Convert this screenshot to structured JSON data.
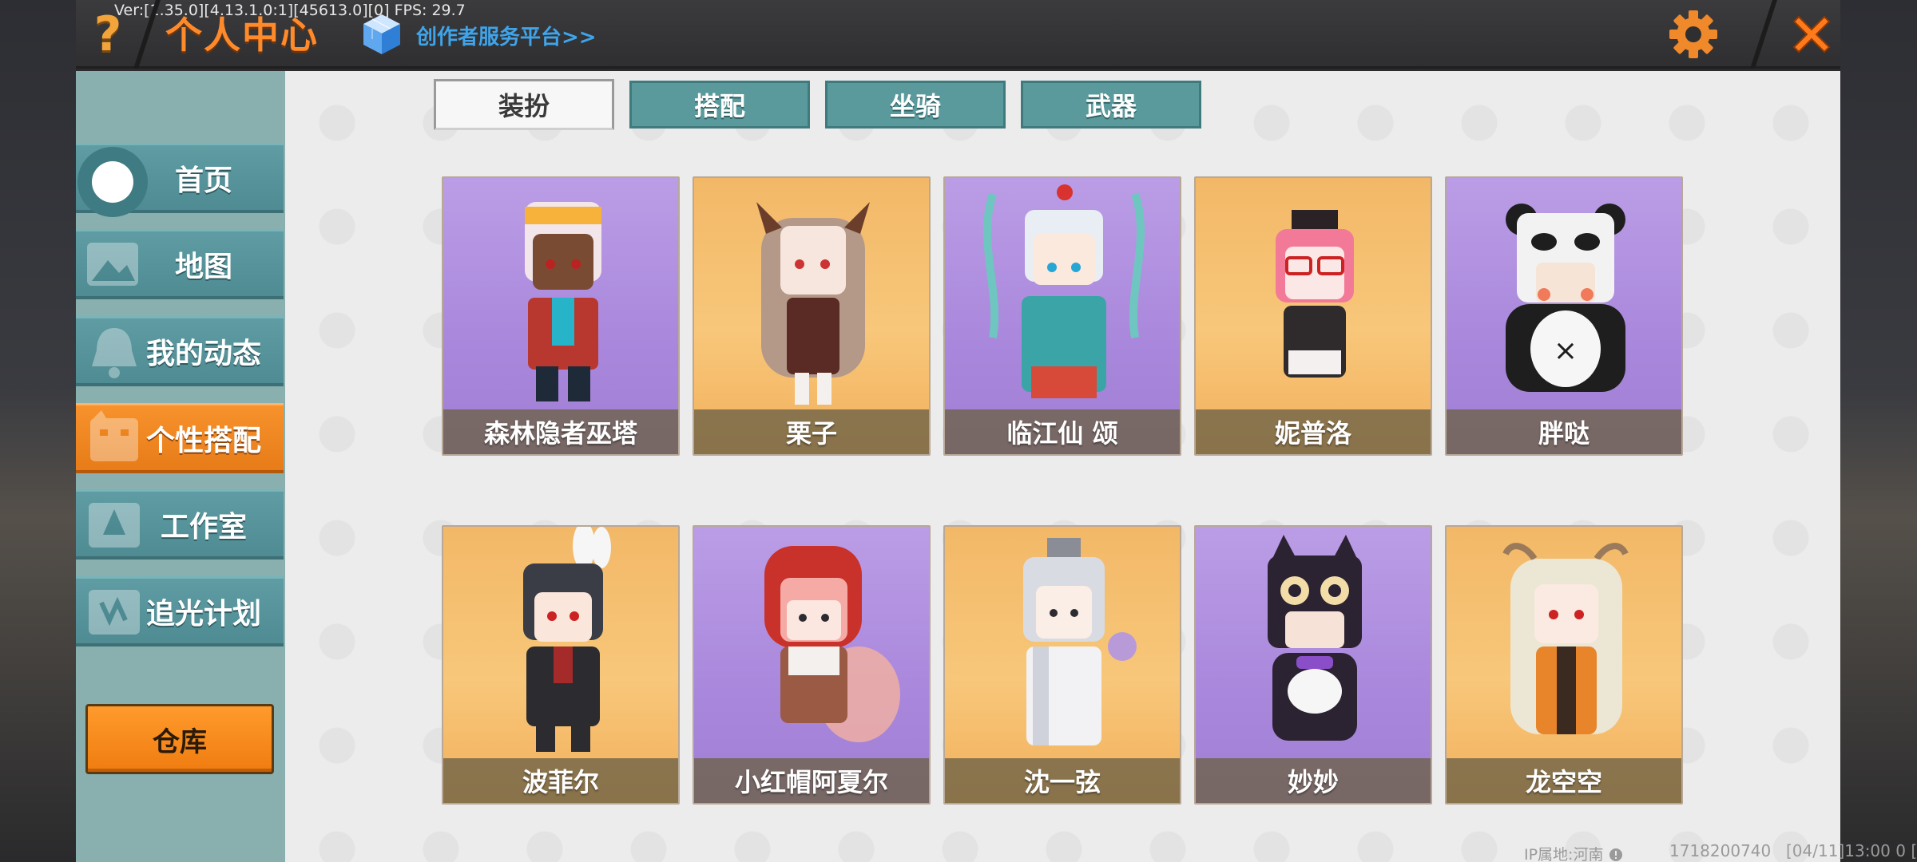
{
  "header": {
    "version": "Ver:[1.35.0][4.13.1.0:1][45613.0][0] FPS: 29.7",
    "title": "个人中心",
    "creator_link": "创作者服务平台>>",
    "help_icon": "question-icon",
    "settings_icon": "gear-icon",
    "close_icon": "close-icon"
  },
  "sidebar": {
    "items": [
      {
        "label": "首页",
        "icon": "home-icon"
      },
      {
        "label": "地图",
        "icon": "map-icon"
      },
      {
        "label": "我的动态",
        "icon": "bell-icon"
      },
      {
        "label": "个性搭配",
        "icon": "outfit-icon"
      },
      {
        "label": "工作室",
        "icon": "studio-icon"
      },
      {
        "label": "追光计划",
        "icon": "plan-icon"
      }
    ],
    "active": "个性搭配",
    "warehouse_label": "仓库"
  },
  "tabs": [
    {
      "label": "装扮",
      "active": true
    },
    {
      "label": "搭配",
      "active": false
    },
    {
      "label": "坐骑",
      "active": false
    },
    {
      "label": "武器",
      "active": false
    }
  ],
  "characters": [
    {
      "name": "森林隐者巫塔",
      "bg": "purple"
    },
    {
      "name": "栗子",
      "bg": "orange"
    },
    {
      "name": "临江仙 颂",
      "bg": "purple"
    },
    {
      "name": "妮普洛",
      "bg": "orange"
    },
    {
      "name": "胖哒",
      "bg": "purple"
    },
    {
      "name": "波菲尔",
      "bg": "orange"
    },
    {
      "name": "小红帽阿夏尔",
      "bg": "purple"
    },
    {
      "name": "沈一弦",
      "bg": "orange"
    },
    {
      "name": "妙妙",
      "bg": "purple"
    },
    {
      "name": "龙空空",
      "bg": "orange"
    }
  ],
  "footer": {
    "ip_location": "IP属地:河南",
    "user_id": "1718200740",
    "time": "[04/11]13:00 0 ["
  },
  "colors": {
    "accent_orange": "#f7922c",
    "nav_teal": "#5f9ca3",
    "card_purple": "#bb9de6",
    "card_orange": "#f2b867"
  }
}
